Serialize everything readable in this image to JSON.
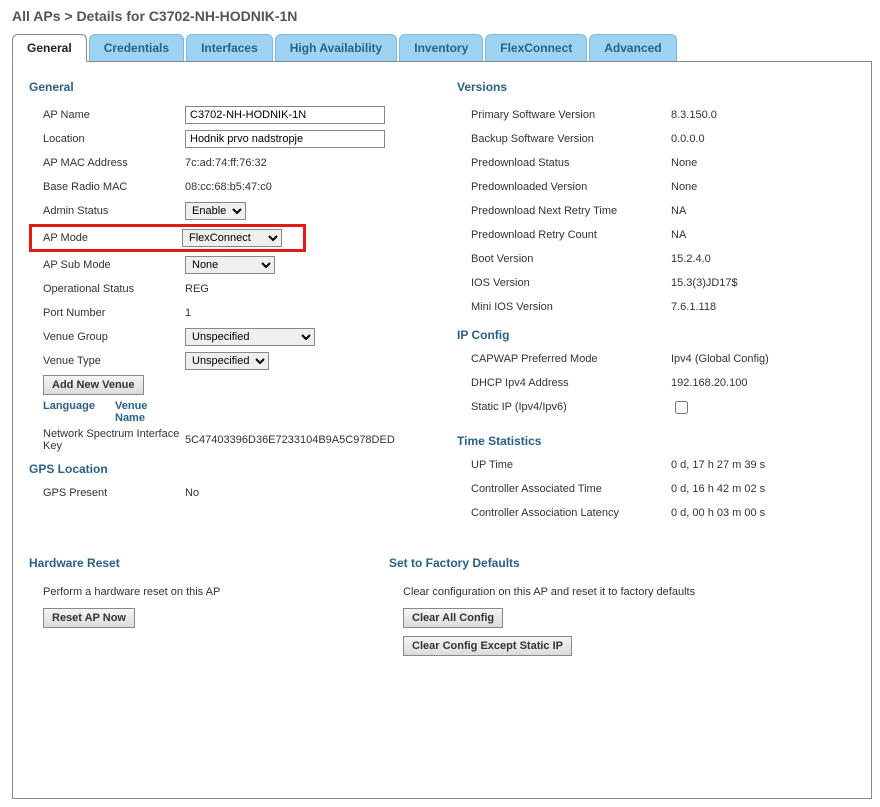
{
  "breadcrumb": "All APs > Details for C3702-NH-HODNIK-1N",
  "tabs": {
    "general": "General",
    "credentials": "Credentials",
    "interfaces": "Interfaces",
    "ha": "High Availability",
    "inventory": "Inventory",
    "flexconnect": "FlexConnect",
    "advanced": "Advanced"
  },
  "general": {
    "title": "General",
    "ap_name_label": "AP Name",
    "ap_name_value": "C3702-NH-HODNIK-1N",
    "location_label": "Location",
    "location_value": "Hodnik prvo nadstropje",
    "ap_mac_label": "AP MAC Address",
    "ap_mac_value": "7c:ad:74:ff:76:32",
    "base_radio_label": "Base Radio MAC",
    "base_radio_value": "08:cc:68:b5:47:c0",
    "admin_status_label": "Admin Status",
    "admin_status_value": "Enable",
    "ap_mode_label": "AP Mode",
    "ap_mode_value": "FlexConnect",
    "ap_sub_mode_label": "AP Sub Mode",
    "ap_sub_mode_value": "None",
    "op_status_label": "Operational Status",
    "op_status_value": "REG",
    "port_label": "Port Number",
    "port_value": "1",
    "venue_group_label": "Venue Group",
    "venue_group_value": "Unspecified",
    "venue_type_label": "Venue Type",
    "venue_type_value": "Unspecified",
    "add_venue_btn": "Add New Venue",
    "venue_lang": "Language",
    "venue_name": "Venue\nName",
    "nsik_label": "Network Spectrum Interface Key",
    "nsik_value": "5C47403396D36E7233104B9A5C978DED"
  },
  "gps": {
    "title": "GPS Location",
    "present_label": "GPS Present",
    "present_value": "No"
  },
  "versions": {
    "title": "Versions",
    "primary_label": "Primary Software Version",
    "primary_value": "8.3.150.0",
    "backup_label": "Backup Software Version",
    "backup_value": "0.0.0.0",
    "predl_status_label": "Predownload Status",
    "predl_status_value": "None",
    "predl_ver_label": "Predownloaded Version",
    "predl_ver_value": "None",
    "predl_retry_time_label": "Predownload Next Retry Time",
    "predl_retry_time_value": "NA",
    "predl_retry_count_label": "Predownload Retry Count",
    "predl_retry_count_value": "NA",
    "boot_label": "Boot Version",
    "boot_value": "15.2.4.0",
    "ios_label": "IOS Version",
    "ios_value": "15.3(3)JD17$",
    "mini_ios_label": "Mini IOS Version",
    "mini_ios_value": "7.6.1.118"
  },
  "ip": {
    "title": "IP Config",
    "capwap_label": "CAPWAP Preferred Mode",
    "capwap_value": "Ipv4 (Global Config)",
    "dhcp_label": "DHCP Ipv4 Address",
    "dhcp_value": "192.168.20.100",
    "static_label": "Static IP (Ipv4/Ipv6)"
  },
  "time": {
    "title": "Time Statistics",
    "uptime_label": "UP Time",
    "uptime_value": "0 d, 17 h 27 m 39 s",
    "assoc_label": "Controller Associated Time",
    "assoc_value": "0 d, 16 h 42 m 02 s",
    "latency_label": "Controller Association Latency",
    "latency_value": "0 d, 00 h 03 m 00 s"
  },
  "hw_reset": {
    "title": "Hardware Reset",
    "desc": "Perform a hardware reset on this AP",
    "btn": "Reset AP Now"
  },
  "factory": {
    "title": "Set to Factory Defaults",
    "desc": "Clear configuration on this AP and reset it to factory defaults",
    "btn_all": "Clear All Config",
    "btn_except": "Clear Config Except Static IP"
  }
}
